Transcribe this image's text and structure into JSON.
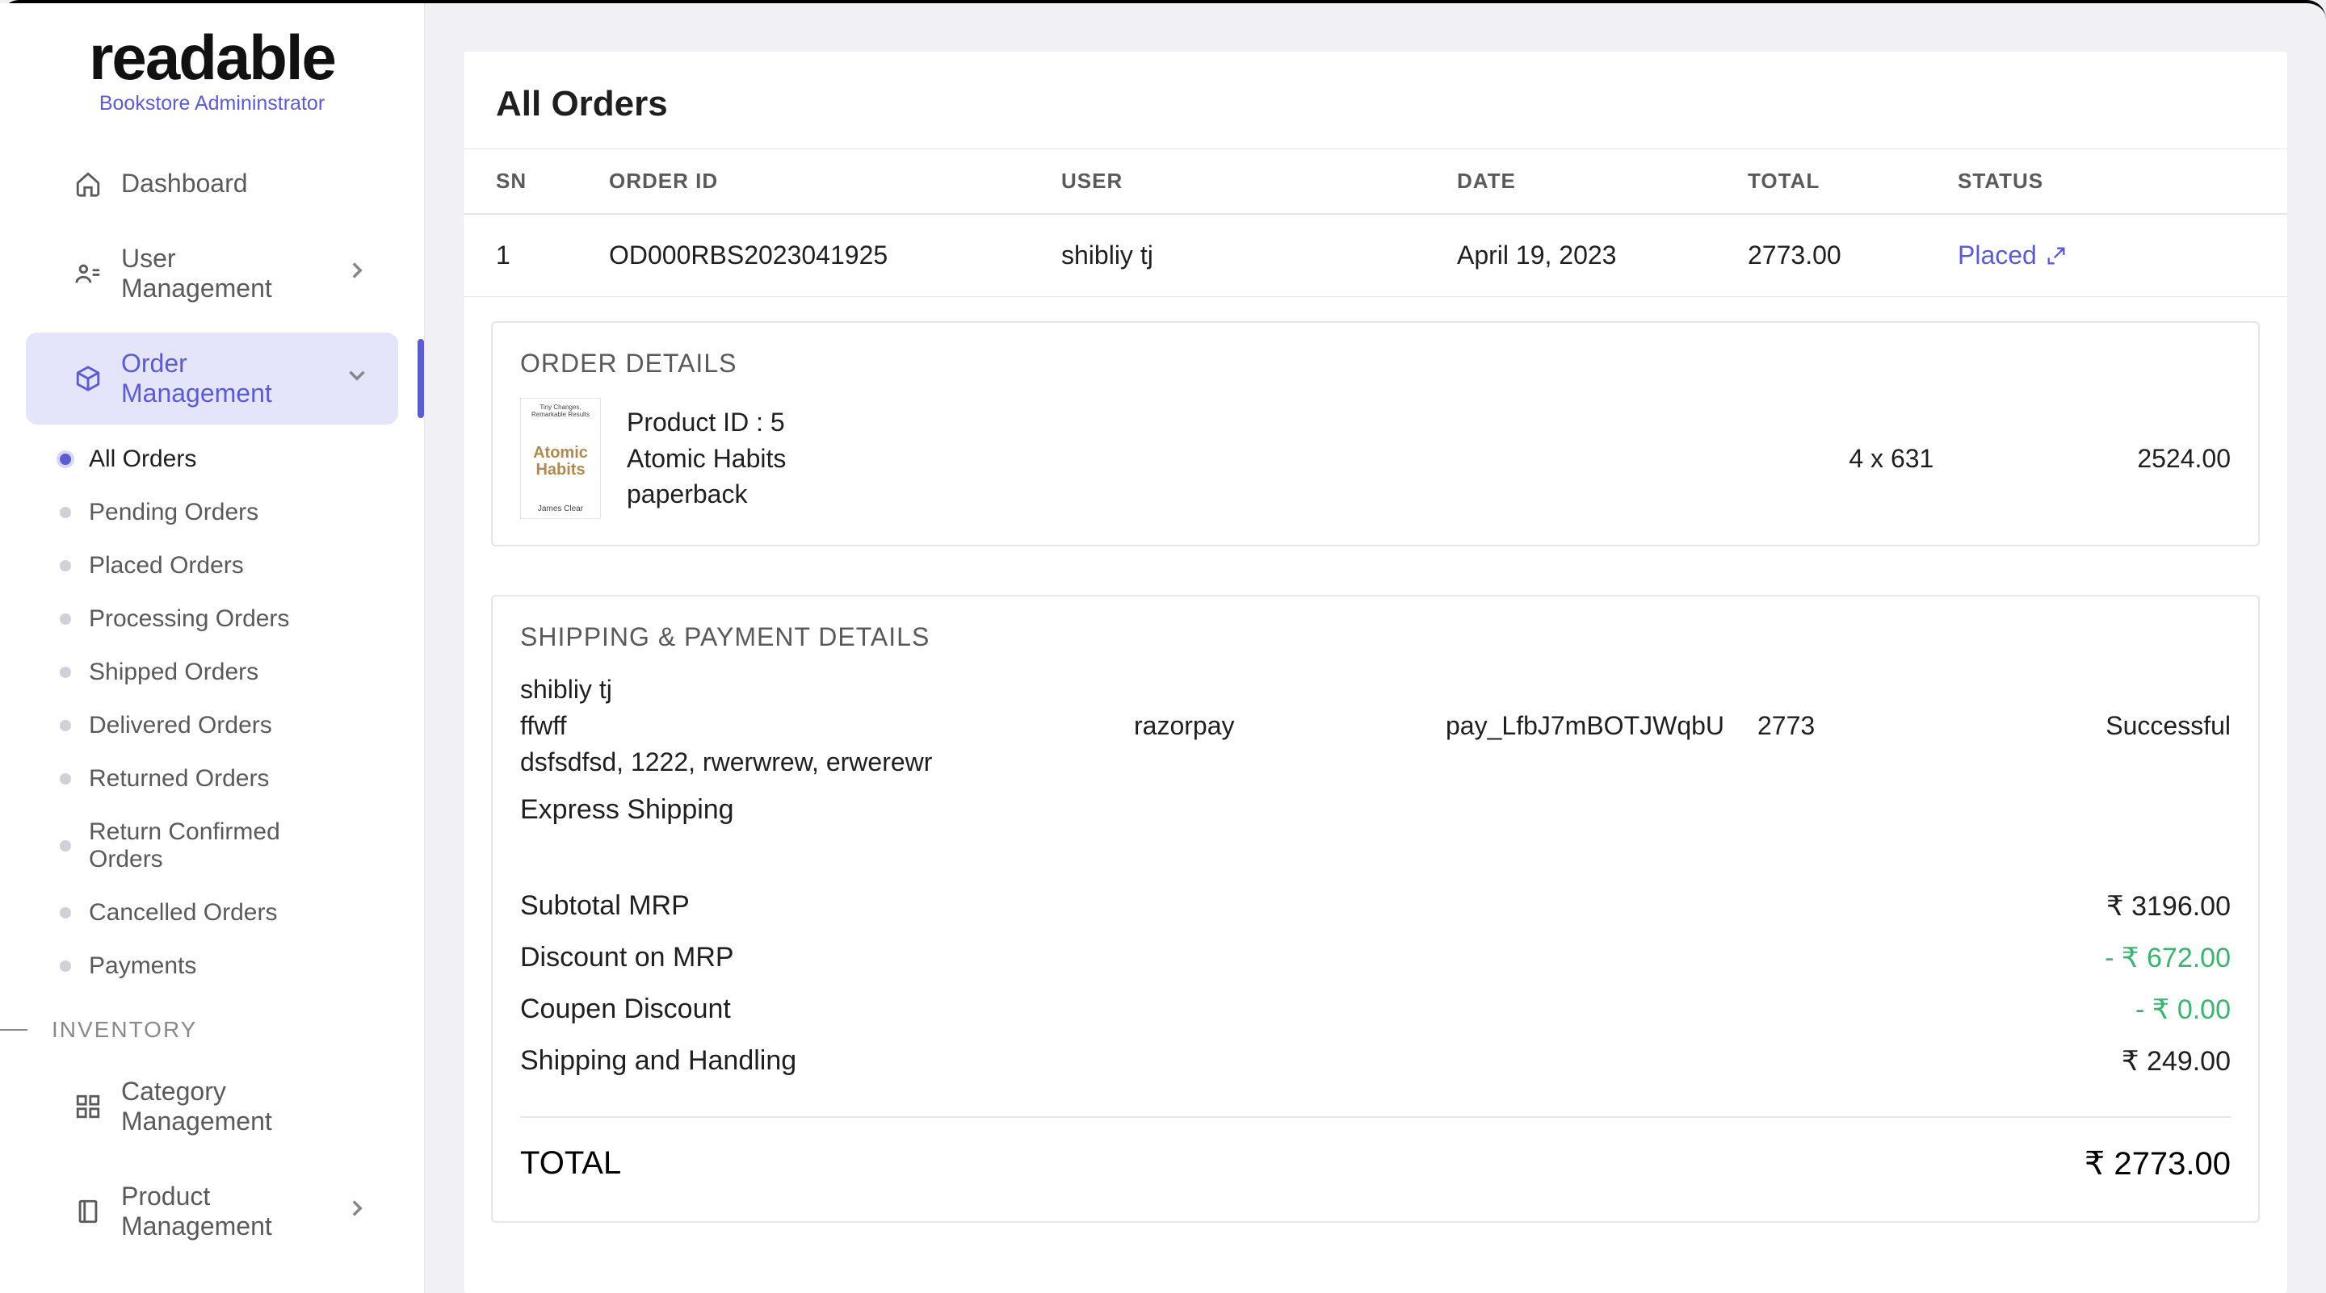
{
  "brand": {
    "name": "readable",
    "subtitle": "Bookstore Admininstrator"
  },
  "sidebar": {
    "dashboard": "Dashboard",
    "user_mgmt": "User Management",
    "order_mgmt": "Order Management",
    "sub": {
      "all": "All Orders",
      "pending": "Pending Orders",
      "placed": "Placed Orders",
      "processing": "Processing Orders",
      "shipped": "Shipped Orders",
      "delivered": "Delivered Orders",
      "returned": "Returned Orders",
      "return_confirmed": "Return Confirmed Orders",
      "cancelled": "Cancelled Orders",
      "payments": "Payments"
    },
    "section_inventory": "INVENTORY",
    "category_mgmt": "Category Management",
    "product_mgmt": "Product Management"
  },
  "main": {
    "title": "All Orders",
    "columns": {
      "sn": "SN",
      "order_id": "ORDER ID",
      "user": "USER",
      "date": "DATE",
      "total": "TOTAL",
      "status": "STATUS"
    },
    "row": {
      "sn": "1",
      "order_id": "OD000RBS2023041925",
      "user": "shibliy tj",
      "date": "April 19, 2023",
      "total": "2773.00",
      "status": "Placed"
    }
  },
  "order_details": {
    "heading": "ORDER DETAILS",
    "thumb": {
      "top": "Tiny Changes, Remarkable Results",
      "mid": "Atomic Habits",
      "bot": "James Clear"
    },
    "product_id_label": "Product ID : 5",
    "title": "Atomic Habits",
    "format": "paperback",
    "qty": "4 x 631",
    "line_total": "2524.00"
  },
  "ship_pay": {
    "heading": "SHIPPING & PAYMENT DETAILS",
    "name": "shibliy tj",
    "addr1": "ffwff",
    "addr2": "dsfsdfsd, 1222, rwerwrew, erwerewr",
    "gateway": "razorpay",
    "payment_id": "pay_LfbJ7mBOTJWqbU",
    "amount": "2773",
    "pay_status": "Successful",
    "ship_method": "Express Shipping"
  },
  "summary": {
    "subtotal_label": "Subtotal MRP",
    "subtotal_val": "₹ 3196.00",
    "discount_label": "Discount on MRP",
    "discount_val": "- ₹ 672.00",
    "coupon_label": "Coupen Discount",
    "coupon_val": "- ₹ 0.00",
    "ship_label": "Shipping and Handling",
    "ship_val": "₹ 249.00",
    "total_label": "TOTAL",
    "total_val": "₹ 2773.00"
  }
}
